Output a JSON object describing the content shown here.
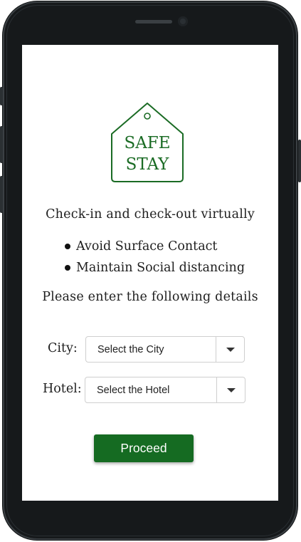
{
  "logo": {
    "line1": "SAFE",
    "line2": "STAY",
    "color": "#1a6b24"
  },
  "tagline": "Check-in and check-out virtually",
  "bullets": [
    "Avoid Surface Contact",
    "Maintain Social distancing"
  ],
  "instructions": "Please enter the following details",
  "city": {
    "label": "City:",
    "selected": "Select the City"
  },
  "hotel": {
    "label": "Hotel:",
    "selected": "Select the Hotel"
  },
  "proceed_label": "Proceed",
  "colors": {
    "accent": "#156b22",
    "frame": "#16191b"
  }
}
